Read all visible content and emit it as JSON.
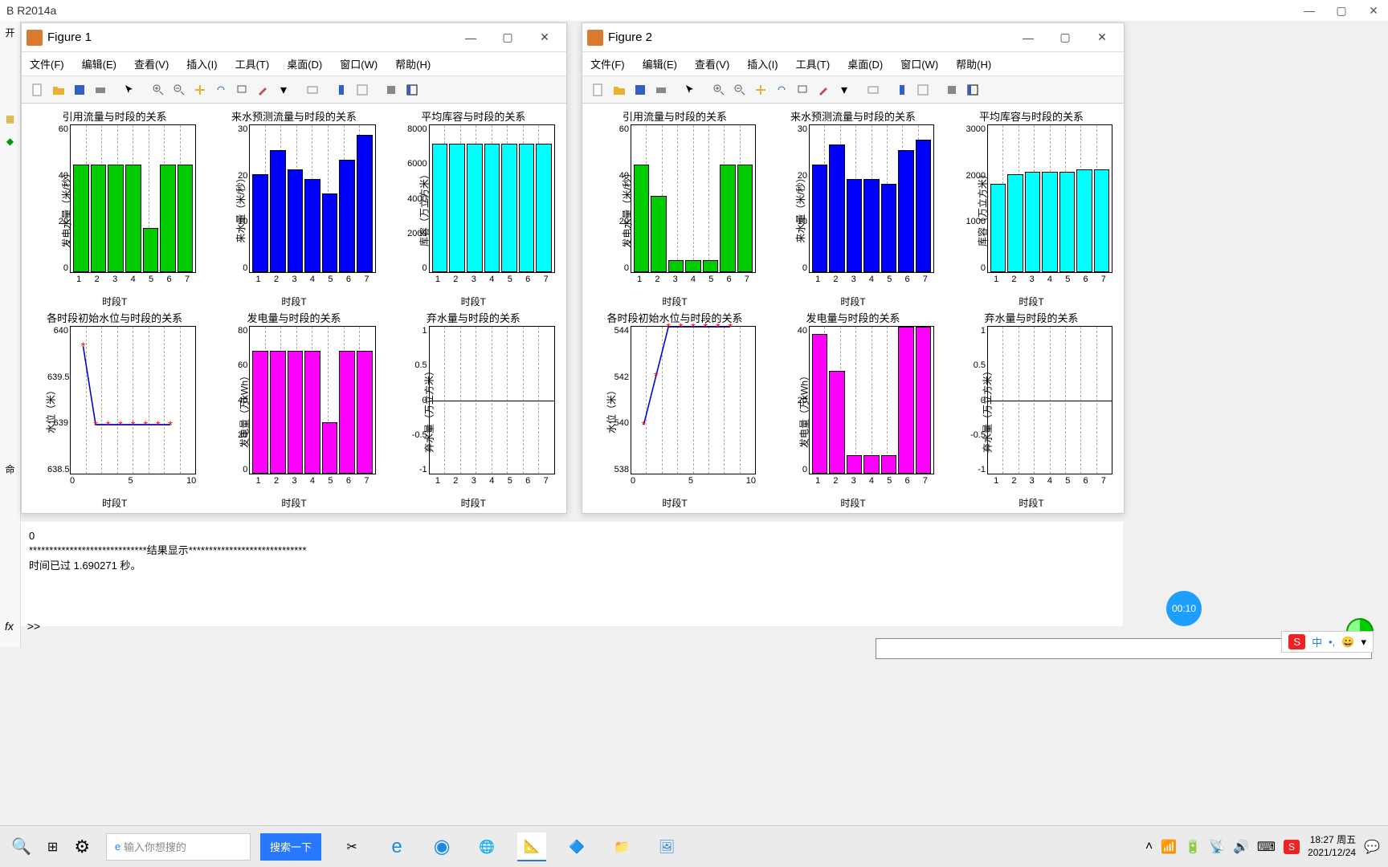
{
  "app": {
    "title": "B R2014a"
  },
  "figures": [
    {
      "title": "Figure 1",
      "menus": [
        "文件(F)",
        "编辑(E)",
        "查看(V)",
        "插入(I)",
        "工具(T)",
        "桌面(D)",
        "窗口(W)",
        "帮助(H)"
      ]
    },
    {
      "title": "Figure 2",
      "menus": [
        "文件(F)",
        "编辑(E)",
        "查看(V)",
        "插入(I)",
        "工具(T)",
        "桌面(D)",
        "窗口(W)",
        "帮助(H)"
      ]
    }
  ],
  "chart_data": [
    {
      "figure": "Figure 1",
      "subplots": [
        {
          "type": "bar",
          "title": "引用流量与时段的关系",
          "xlabel": "时段T",
          "ylabel": "发电水量（米/秒）",
          "categories": [
            "1",
            "2",
            "3",
            "4",
            "5",
            "6",
            "7"
          ],
          "values": [
            44,
            44,
            44,
            44,
            18,
            44,
            44
          ],
          "color": "green",
          "ylim": [
            0,
            60
          ],
          "yticks": [
            0,
            20,
            40,
            60
          ],
          "grid": true
        },
        {
          "type": "bar",
          "title": "来水预测流量与时段的关系",
          "xlabel": "时段T",
          "ylabel": "来水量（米/秒）",
          "categories": [
            "1",
            "2",
            "3",
            "4",
            "5",
            "6",
            "7"
          ],
          "values": [
            20,
            25,
            21,
            19,
            16,
            23,
            28
          ],
          "color": "blue",
          "ylim": [
            0,
            30
          ],
          "yticks": [
            0,
            10,
            20,
            30
          ],
          "grid": true
        },
        {
          "type": "bar",
          "title": "平均库容与时段的关系",
          "xlabel": "时段T",
          "ylabel": "库容（万立方米）",
          "categories": [
            "1",
            "2",
            "3",
            "4",
            "5",
            "6",
            "7"
          ],
          "values": [
            7000,
            7000,
            7000,
            7000,
            7000,
            7000,
            7000
          ],
          "color": "cyan",
          "ylim": [
            0,
            8000
          ],
          "yticks": [
            0,
            2000,
            4000,
            6000,
            8000
          ],
          "grid": true
        },
        {
          "type": "line",
          "title": "各时段初始水位与时段的关系",
          "xlabel": "时段T",
          "ylabel": "水位（米）",
          "x": [
            1,
            2,
            3,
            4,
            5,
            6,
            7,
            8
          ],
          "y": [
            639.8,
            639,
            639,
            639,
            639,
            639,
            639,
            639
          ],
          "marker": "*",
          "color": "red",
          "ylim": [
            638.5,
            640
          ],
          "yticks": [
            638.5,
            639,
            639.5,
            640
          ],
          "xlim": [
            0,
            10
          ],
          "xticks": [
            0,
            5,
            10
          ],
          "grid": true
        },
        {
          "type": "bar",
          "title": "发电量与时段的关系",
          "xlabel": "时段T",
          "ylabel": "发电量（万kWh）",
          "categories": [
            "1",
            "2",
            "3",
            "4",
            "5",
            "6",
            "7"
          ],
          "values": [
            67,
            67,
            67,
            67,
            28,
            67,
            67
          ],
          "color": "magenta",
          "ylim": [
            0,
            80
          ],
          "yticks": [
            0,
            20,
            40,
            60,
            80
          ],
          "grid": true
        },
        {
          "type": "bar",
          "title": "弃水量与时段的关系",
          "xlabel": "时段T",
          "ylabel": "弃水量（万立方米）",
          "categories": [
            "1",
            "2",
            "3",
            "4",
            "5",
            "6",
            "7"
          ],
          "values": [
            0,
            0,
            0,
            0,
            0,
            0,
            0
          ],
          "color": "none",
          "ylim": [
            -1,
            1
          ],
          "yticks": [
            -1,
            -0.5,
            0,
            0.5,
            1
          ],
          "grid": true
        }
      ]
    },
    {
      "figure": "Figure 2",
      "subplots": [
        {
          "type": "bar",
          "title": "引用流量与时段的关系",
          "xlabel": "时段T",
          "ylabel": "发电水量（米/秒）",
          "categories": [
            "1",
            "2",
            "3",
            "4",
            "5",
            "6",
            "7"
          ],
          "values": [
            44,
            31,
            5,
            5,
            5,
            44,
            44
          ],
          "color": "green",
          "ylim": [
            0,
            60
          ],
          "yticks": [
            0,
            20,
            40,
            60
          ],
          "grid": true
        },
        {
          "type": "bar",
          "title": "来水预测流量与时段的关系",
          "xlabel": "时段T",
          "ylabel": "来水量（米/秒）",
          "categories": [
            "1",
            "2",
            "3",
            "4",
            "5",
            "6",
            "7"
          ],
          "values": [
            22,
            26,
            19,
            19,
            18,
            25,
            27
          ],
          "color": "blue",
          "ylim": [
            0,
            30
          ],
          "yticks": [
            0,
            10,
            20,
            30
          ],
          "grid": true
        },
        {
          "type": "bar",
          "title": "平均库容与时段的关系",
          "xlabel": "时段T",
          "ylabel": "库容（万立方米）",
          "categories": [
            "1",
            "2",
            "3",
            "4",
            "5",
            "6",
            "7"
          ],
          "values": [
            1800,
            2000,
            2050,
            2050,
            2050,
            2100,
            2100
          ],
          "color": "cyan",
          "ylim": [
            0,
            3000
          ],
          "yticks": [
            0,
            1000,
            2000,
            3000
          ],
          "grid": true
        },
        {
          "type": "line",
          "title": "各时段初始水位与时段的关系",
          "xlabel": "时段T",
          "ylabel": "水位（米）",
          "x": [
            1,
            2,
            3,
            4,
            5,
            6,
            7,
            8
          ],
          "y": [
            540,
            542,
            544,
            544,
            544,
            544,
            544,
            544
          ],
          "marker": "*",
          "color": "red",
          "ylim": [
            538,
            544
          ],
          "yticks": [
            538,
            540,
            542,
            544
          ],
          "xlim": [
            0,
            10
          ],
          "xticks": [
            0,
            5,
            10
          ],
          "grid": true
        },
        {
          "type": "bar",
          "title": "发电量与时段的关系",
          "xlabel": "时段T",
          "ylabel": "发电量（万kWh）",
          "categories": [
            "1",
            "2",
            "3",
            "4",
            "5",
            "6",
            "7"
          ],
          "values": [
            38,
            28,
            5,
            5,
            5,
            40,
            40
          ],
          "color": "magenta",
          "ylim": [
            0,
            40
          ],
          "yticks": [
            0,
            20,
            40
          ],
          "grid": true
        },
        {
          "type": "bar",
          "title": "弃水量与时段的关系",
          "xlabel": "时段T",
          "ylabel": "弃水量（万立方米）",
          "categories": [
            "1",
            "2",
            "3",
            "4",
            "5",
            "6",
            "7"
          ],
          "values": [
            0,
            0,
            0,
            0,
            0,
            0,
            0
          ],
          "color": "none",
          "ylim": [
            -1,
            1
          ],
          "yticks": [
            -1,
            -0.5,
            0,
            0.5,
            1
          ],
          "grid": true
        }
      ]
    }
  ],
  "command_window": {
    "lines": [
      "     0",
      "",
      "*****************************结果显示*****************************",
      "时间已过 1.690271 秒。"
    ],
    "prompt": ">>"
  },
  "timer_badge": "00:10",
  "ime": {
    "s": "S",
    "zhong": "中",
    "smiley": "😀",
    "more": "▾"
  },
  "taskbar": {
    "search_placeholder": "输入你想搜的",
    "search_button": "搜索一下",
    "clock_time": "18:27 周五",
    "clock_date": "2021/12/24"
  },
  "sidebar": {
    "kai": "开",
    "ming": "命",
    "fx": "fx"
  }
}
